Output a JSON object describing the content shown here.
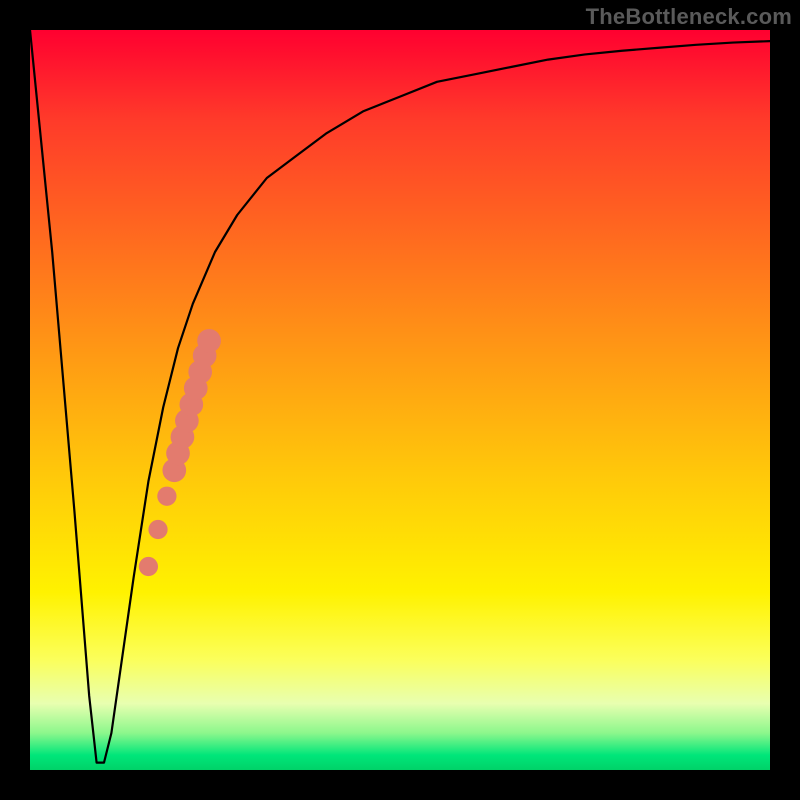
{
  "watermark": "TheBottleneck.com",
  "colors": {
    "background": "#000000",
    "curve": "#000000",
    "marker_fill": "#e37b6e",
    "gradient_top": "#ff0030",
    "gradient_bottom": "#00d268"
  },
  "chart_data": {
    "type": "line",
    "title": "",
    "xlabel": "",
    "ylabel": "",
    "xlim": [
      0,
      100
    ],
    "ylim": [
      0,
      100
    ],
    "description": "Bottleneck curve: a sharp V-shaped dip near the low end of the x-axis reaching ~0 (green/optimal), then a steep logarithmic climb asymptoting near the top (red/severe bottleneck). A short cluster of salmon markers lies on the rising flank just above the dip.",
    "series": [
      {
        "name": "bottleneck-curve",
        "x": [
          0,
          3,
          6,
          8,
          9,
          10,
          11,
          12,
          14,
          16,
          18,
          20,
          22,
          25,
          28,
          32,
          36,
          40,
          45,
          50,
          55,
          60,
          65,
          70,
          75,
          80,
          85,
          90,
          95,
          100
        ],
        "y": [
          100,
          70,
          35,
          10,
          1,
          1,
          5,
          12,
          26,
          39,
          49,
          57,
          63,
          70,
          75,
          80,
          83,
          86,
          89,
          91,
          93,
          94,
          95,
          96,
          96.7,
          97.2,
          97.6,
          98,
          98.3,
          98.5
        ]
      }
    ],
    "markers": {
      "name": "highlighted-points",
      "color": "#e37b6e",
      "points": [
        {
          "x": 16.0,
          "y": 27.5,
          "r": 1.3
        },
        {
          "x": 17.3,
          "y": 32.5,
          "r": 1.3
        },
        {
          "x": 18.5,
          "y": 37.0,
          "r": 1.3
        },
        {
          "x": 19.5,
          "y": 40.5,
          "r": 1.6
        },
        {
          "x": 20.0,
          "y": 42.8,
          "r": 1.6
        },
        {
          "x": 20.6,
          "y": 45.0,
          "r": 1.6
        },
        {
          "x": 21.2,
          "y": 47.2,
          "r": 1.6
        },
        {
          "x": 21.8,
          "y": 49.4,
          "r": 1.6
        },
        {
          "x": 22.4,
          "y": 51.6,
          "r": 1.6
        },
        {
          "x": 23.0,
          "y": 53.8,
          "r": 1.6
        },
        {
          "x": 23.6,
          "y": 56.0,
          "r": 1.6
        },
        {
          "x": 24.2,
          "y": 58.0,
          "r": 1.6
        }
      ]
    }
  }
}
